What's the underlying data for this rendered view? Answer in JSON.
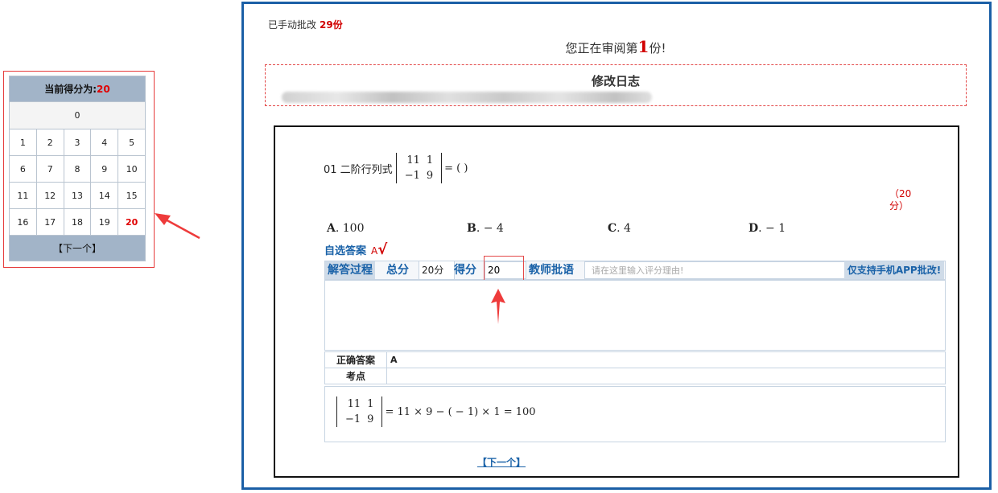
{
  "score_panel": {
    "current_score_label": "当前得分为:",
    "current_score_value": "20",
    "zero_row": "0",
    "rows": [
      [
        "1",
        "2",
        "3",
        "4",
        "5"
      ],
      [
        "6",
        "7",
        "8",
        "9",
        "10"
      ],
      [
        "11",
        "12",
        "13",
        "14",
        "15"
      ],
      [
        "16",
        "17",
        "18",
        "19",
        "20"
      ]
    ],
    "selected": "20",
    "next_label": "【下一个】"
  },
  "header": {
    "graded_label": "已手动批改",
    "graded_count": "29份",
    "reviewing_prefix": "您正在审阅第",
    "reviewing_number": "1",
    "reviewing_suffix": "份!",
    "log_title": "修改日志"
  },
  "question": {
    "number_text": "01 二阶行列式",
    "matrix": [
      [
        "11",
        "1"
      ],
      [
        "−1",
        "9"
      ]
    ],
    "equals": "= ( )",
    "score_note_line1": "（20",
    "score_note_line2": "分）",
    "options": [
      {
        "letter": "A",
        "text": ". 100"
      },
      {
        "letter": "B",
        "text": ". − 4"
      },
      {
        "letter": "C",
        "text": ". 4"
      },
      {
        "letter": "D",
        "text": ". − 1"
      }
    ],
    "self_answer_label": "自选答案",
    "self_answer_value": "A",
    "self_answer_mark": "√"
  },
  "grading": {
    "process_label": "解答过程",
    "total_label": "总分",
    "total_value": "20分",
    "score_label": "得分",
    "score_value": "20",
    "comment_label": "教师批语",
    "comment_placeholder": "请在这里输入评分理由!",
    "app_only_label": "仅支持手机APP批改!"
  },
  "answer_info": {
    "correct_label": "正确答案",
    "correct_value": "A",
    "point_label": "考点",
    "point_value": "",
    "solution_matrix": [
      [
        "11",
        "1"
      ],
      [
        "−1",
        "9"
      ]
    ],
    "solution_rhs": "= 11 × 9 − ( − 1) × 1 = 100"
  },
  "footer": {
    "next_label": "【下一个】"
  }
}
